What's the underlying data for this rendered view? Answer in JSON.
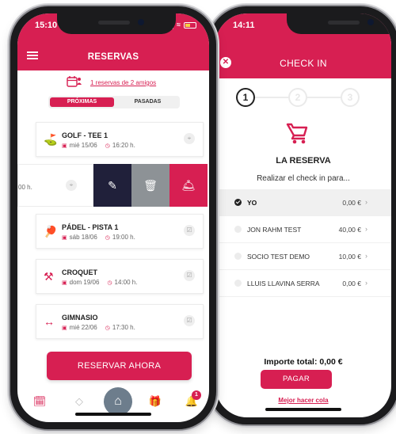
{
  "reservas_screen": {
    "status_time": "15:10",
    "title": "RESERVAS",
    "friends_text": "1 reservas de 2 amigos",
    "tabs": [
      "PRÓXIMAS",
      "PASADAS"
    ],
    "cards": [
      {
        "title": "GOLF - TEE 1",
        "date": "mié 15/06",
        "time": "16:20 h."
      },
      {
        "title": "PÁDEL - PISTA 1",
        "date": "sáb 18/06",
        "time": "19:00 h."
      },
      {
        "title": "CROQUET",
        "date": "dom 19/06",
        "time": "14:00 h."
      },
      {
        "title": "GIMNASIO",
        "date": "mié 22/06",
        "time": "17:30 h."
      }
    ],
    "swiped_time": "00 h.",
    "cta": "RESERVAR AHORA",
    "notification_count": "1"
  },
  "checkin_screen": {
    "status_time": "14:11",
    "title": "CHECK IN",
    "steps": [
      "1",
      "2",
      "3"
    ],
    "subtitle": "LA RESERVA",
    "hint": "Realizar el check in para...",
    "players": [
      {
        "name": "YO",
        "price": "0,00 €",
        "selected": true
      },
      {
        "name": "JON RAHM TEST",
        "price": "40,00 €",
        "selected": false
      },
      {
        "name": "SOCIO TEST DEMO",
        "price": "10,00 €",
        "selected": false
      },
      {
        "name": "LLUIS LLAVINA SERRA",
        "price": "0,00 €",
        "selected": false
      }
    ],
    "total_label": "Importe total:",
    "total_value": "0,00 €",
    "pay_button": "PAGAR",
    "queue_link": "Mejor hacer cola"
  },
  "colors": {
    "brand": "#d71f52",
    "edit_action": "#20203a",
    "delete_action": "#8d9296",
    "home_button": "#6d7d8c"
  },
  "icons": [
    "menu-icon",
    "calendar-friends-icon",
    "golf-icon",
    "paddle-icon",
    "croquet-icon",
    "gym-icon",
    "calendar-icon",
    "clock-icon",
    "location-icon",
    "checkin-icon",
    "edit-icon",
    "trash-icon",
    "bell-service-icon",
    "ticket-icon",
    "home-icon",
    "gift-icon",
    "notification-icon",
    "close-icon",
    "cart-icon",
    "chevron-right-icon"
  ]
}
